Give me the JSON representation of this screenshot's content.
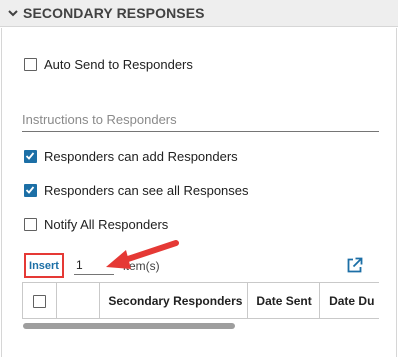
{
  "section": {
    "title": "SECONDARY RESPONSES"
  },
  "options": {
    "auto_send": {
      "label": "Auto Send to Responders",
      "checked": false
    },
    "instructions_placeholder": "Instructions to Responders",
    "can_add": {
      "label": "Responders can add Responders",
      "checked": true
    },
    "can_see": {
      "label": "Responders can see all Responses",
      "checked": true
    },
    "notify_all": {
      "label": "Notify All Responders",
      "checked": false
    }
  },
  "toolbar": {
    "insert_label": "Insert",
    "quantity_value": "1",
    "items_label": "item(s)"
  },
  "table": {
    "columns": [
      "",
      "",
      "Secondary Responders",
      "Date Sent",
      "Date Du"
    ]
  },
  "colors": {
    "accent": "#1c6fa6",
    "highlight": "#e53935"
  },
  "icons": {
    "collapse": "chevron-down-icon",
    "popout": "external-link-icon"
  }
}
